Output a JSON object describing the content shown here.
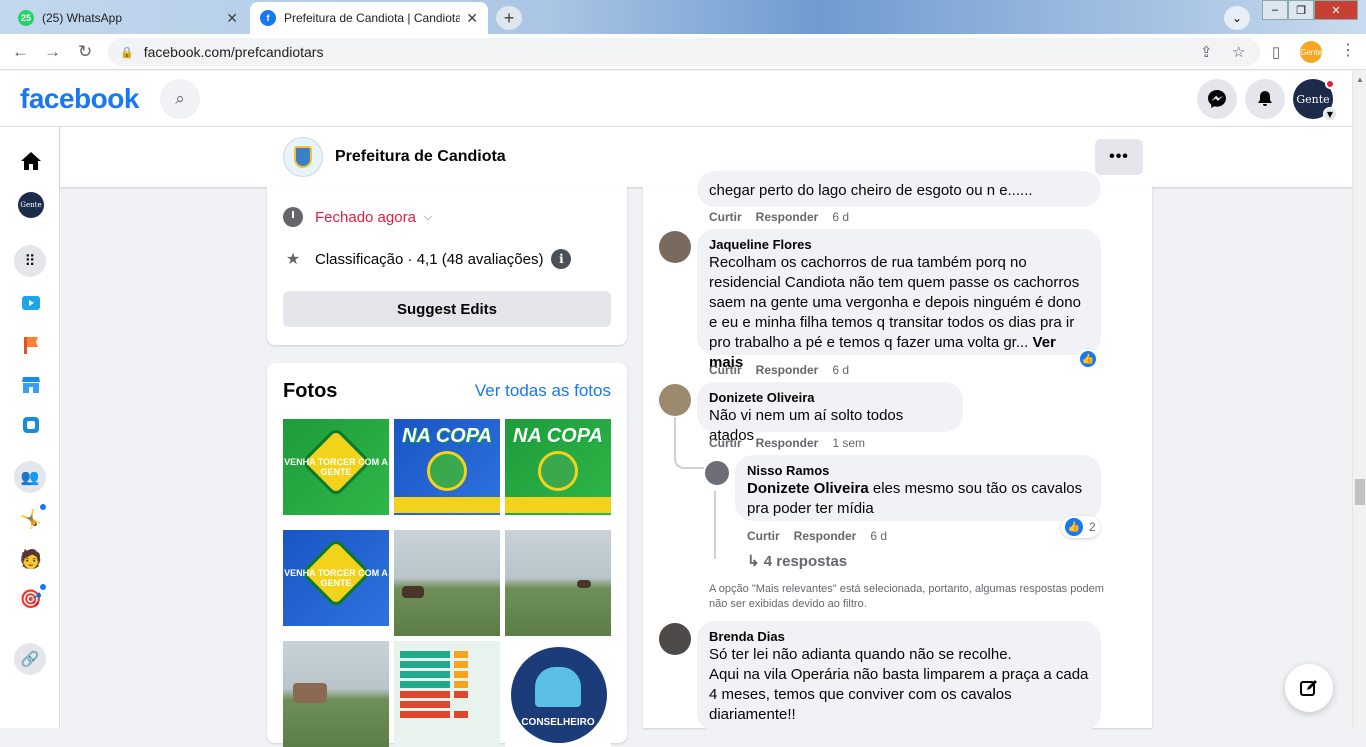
{
  "browser": {
    "tabs": [
      {
        "title": "(25) WhatsApp",
        "favicon_text": "25",
        "favicon_color": "#25d366"
      },
      {
        "title": "Prefeitura de Candiota | Candiota",
        "favicon_text": "f",
        "favicon_color": "#1877f2"
      }
    ],
    "url": "facebook.com/prefcandiotars",
    "profile_label": "Gente"
  },
  "header": {
    "logo": "facebook",
    "avatar_label": "Gente"
  },
  "rail": {
    "avatar_label": "Gente"
  },
  "page": {
    "title": "Prefeitura de Candiota"
  },
  "info": {
    "status": "Fechado agora",
    "rating": "Classificação · 4,1 (48 avaliações)",
    "suggest_button": "Suggest Edits"
  },
  "photos": {
    "title": "Fotos",
    "see_all": "Ver todas as fotos",
    "badge_text": "VENHA TORCER COM A GENTE",
    "copa_text": "NA COPA",
    "council_text": "CONSELHEIRO"
  },
  "comments": [
    {
      "text": "chegar perto do lago cheiro de esgoto ou n e......",
      "like": "Curtir",
      "reply": "Responder",
      "time": "6 d"
    },
    {
      "name": "Jaqueline Flores",
      "lines": [
        "Recolham os cachorros de rua também porq no",
        "residencial Candiota não tem quem passe os cachorros",
        "saem na gente uma vergonha e depois ninguém é dono",
        "e eu e minha filha temos q transitar todos os dias pra ir",
        "pro trabalho a pé e temos q fazer uma volta gr..."
      ],
      "see_more": "Ver mais",
      "like": "Curtir",
      "reply": "Responder",
      "time": "6 d"
    },
    {
      "name": "Donizete Oliveira",
      "text": "Não vi nem um aí solto todos atados",
      "like": "Curtir",
      "reply": "Responder",
      "time": "1 sem"
    },
    {
      "name": "Nisso Ramos",
      "mention": "Donizete Oliveira",
      "text": " eles mesmo sou tão os cavalos",
      "text2": "pra poder ter mídia",
      "like_count": "2",
      "like": "Curtir",
      "reply": "Responder",
      "time": "6 d"
    },
    {
      "name": "Brenda Dias",
      "lines": [
        "Só ter lei não adianta quando não se recolhe.",
        "Aqui na vila Operária não basta limparem a praça a cada",
        "4 meses, temos que conviver com os cavalos",
        "diariamente!!"
      ]
    }
  ],
  "replies_link": "4 respostas",
  "filter_note": [
    "A opção \"Mais relevantes\" está selecionada, portanto, algumas respostas podem",
    "não ser exibidas devido ao filtro."
  ]
}
